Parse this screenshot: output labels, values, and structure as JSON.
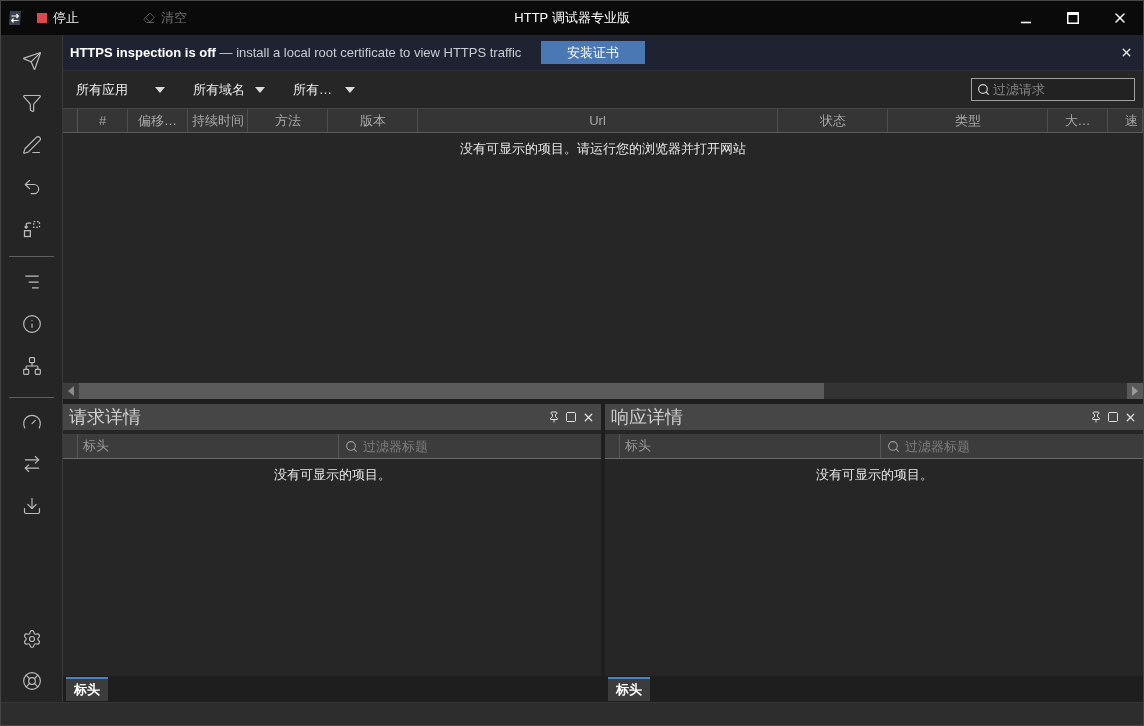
{
  "window": {
    "title": "HTTP 调试器专业版"
  },
  "toolbar": [
    {
      "kind": "stop",
      "label": "停止",
      "disabled": false
    },
    {
      "kind": "clear",
      "label": "清空",
      "disabled": true
    }
  ],
  "banner": {
    "message": "**HTTPS inspection is off** — install a local root certificate to view HTTPS traffic",
    "button": "安装证书"
  },
  "filters": [
    {
      "label": "所有应用"
    },
    {
      "label": "所有域名"
    },
    {
      "label": "所有…"
    }
  ],
  "search": {
    "placeholder": "过滤请求"
  },
  "table": {
    "columns": [
      "#",
      "偏移…",
      "持续时间",
      "方法",
      "版本",
      "Url",
      "状态",
      "类型",
      "大…",
      "速"
    ],
    "empty_message": "没有可显示的项目。请运行您的浏览器并打开网站"
  },
  "panels": [
    {
      "title": "请求详情",
      "columns": [
        "标头"
      ],
      "filter": {
        "placeholder": "过滤器标题"
      },
      "empty_message": "没有可显示的项目。",
      "tabs": [
        {
          "label": "标头",
          "selected": true
        }
      ]
    },
    {
      "title": "响应详情",
      "columns": [
        "标头"
      ],
      "filter": {
        "placeholder": "过滤器标题"
      },
      "empty_message": "没有可显示的项目。",
      "tabs": [
        {
          "label": "标头",
          "selected": true
        }
      ]
    }
  ]
}
